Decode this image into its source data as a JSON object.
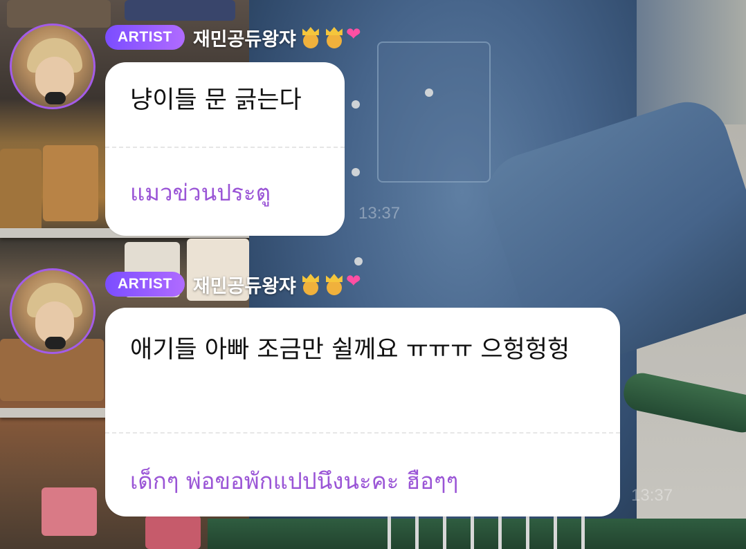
{
  "messages": [
    {
      "badge": "ARTIST",
      "username": "재민공듀왕쟈",
      "emojis": [
        "prince-emoji",
        "prince-emoji",
        "two-hearts-emoji"
      ],
      "text": "냥이들 문 긁는다",
      "translation": "แมวข่วนประตู"
    },
    {
      "badge": "ARTIST",
      "username": "재민공듀왕쟈",
      "emojis": [
        "prince-emoji",
        "prince-emoji",
        "two-hearts-emoji"
      ],
      "text": "애기들 아빠 조금만 쉴께요 ㅠㅠㅠ 으헝헝헝",
      "translation": "เด็กๆ พ่อขอพักแปปนึงนะคะ ฮือๆๆ"
    }
  ],
  "timestamps": [
    "13:37",
    "13:37"
  ],
  "colors": {
    "badge": "#8a55ff",
    "translation": "#9a55d6",
    "avatar_ring": "#a35ce8"
  }
}
